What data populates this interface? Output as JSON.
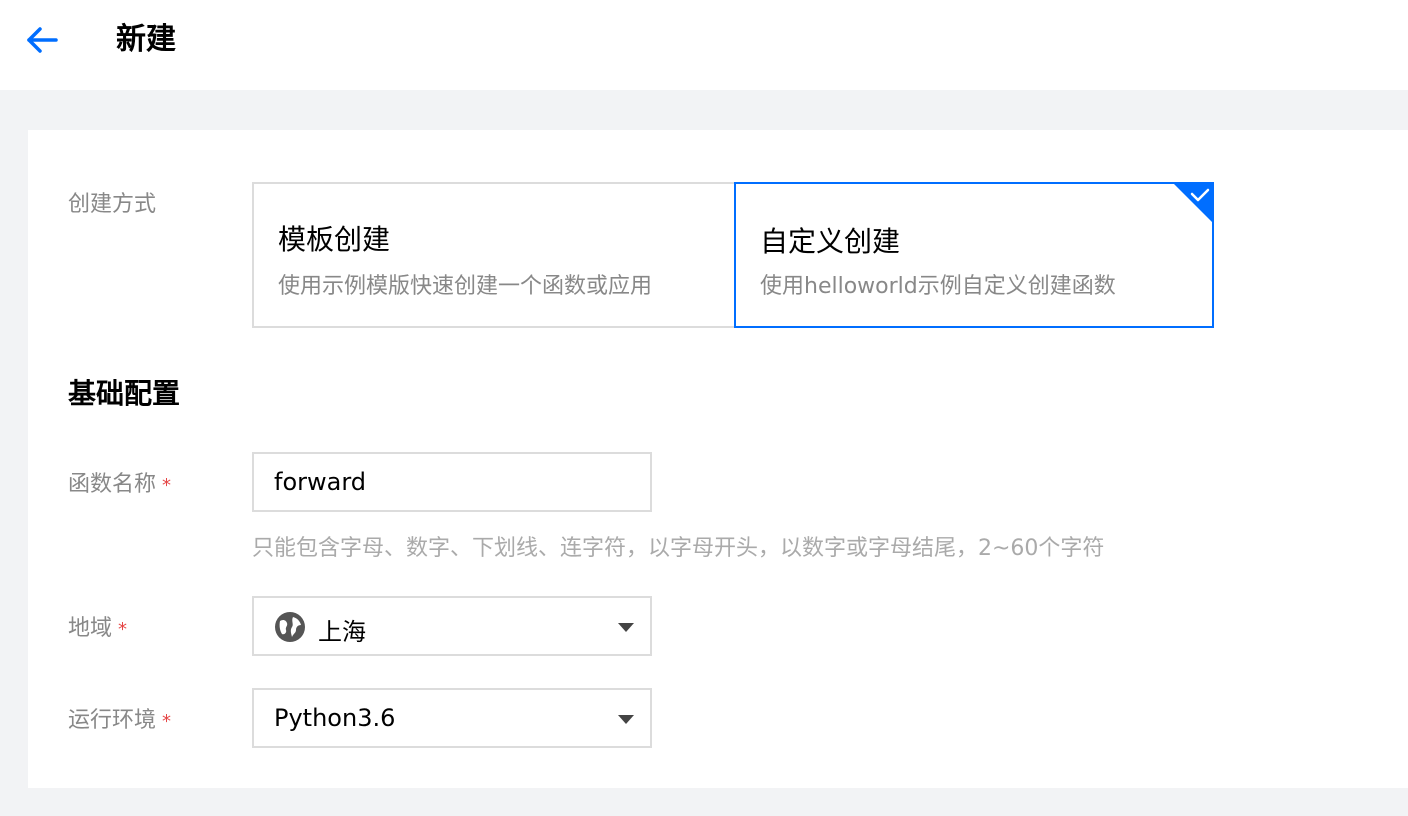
{
  "header": {
    "back_icon": "arrow-left-icon",
    "title": "新建"
  },
  "colors": {
    "accent": "#006eff",
    "required": "#e54545",
    "label": "#888888",
    "hint": "#aaaaaa",
    "background": "#f2f3f5"
  },
  "create_method": {
    "label": "创建方式",
    "options": [
      {
        "title": "模板创建",
        "desc": "使用示例模版快速创建一个函数或应用",
        "selected": false
      },
      {
        "title": "自定义创建",
        "desc": "使用helloworld示例自定义创建函数",
        "selected": true
      }
    ]
  },
  "basic_config": {
    "section_title": "基础配置",
    "function_name": {
      "label": "函数名称",
      "required_mark": "*",
      "value": "forward",
      "hint": "只能包含字母、数字、下划线、连字符，以字母开头，以数字或字母结尾，2~60个字符"
    },
    "region": {
      "label": "地域",
      "required_mark": "*",
      "icon": "globe-icon",
      "value": "上海"
    },
    "runtime": {
      "label": "运行环境",
      "required_mark": "*",
      "value": "Python3.6"
    }
  }
}
